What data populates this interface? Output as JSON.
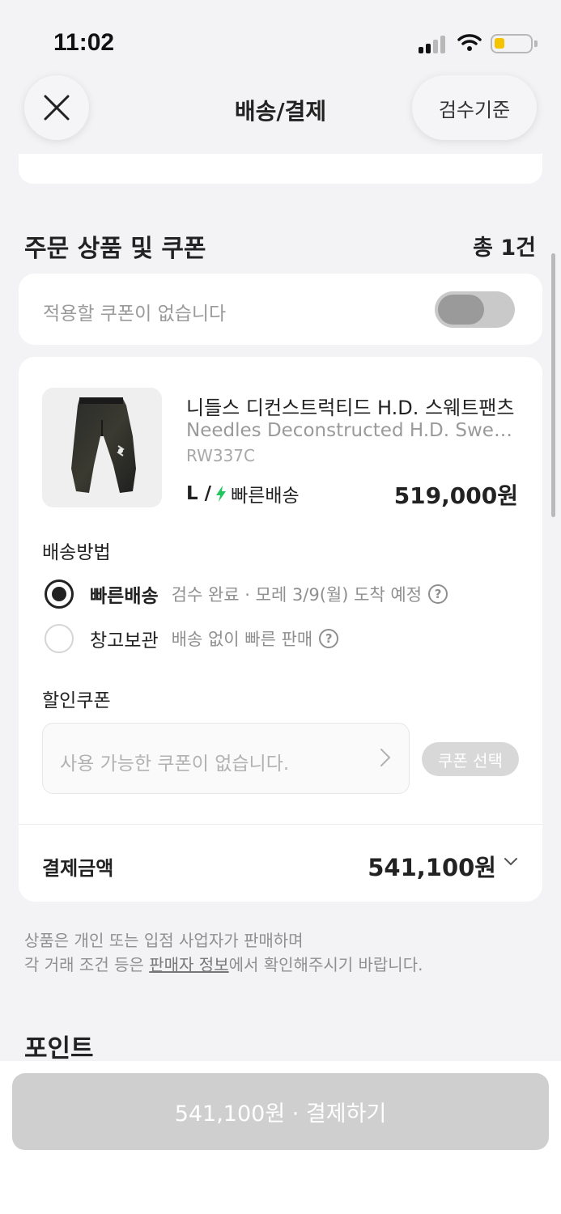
{
  "status_bar": {
    "time": "11:02"
  },
  "header": {
    "title": "배송/결제",
    "inspection_label": "검수기준"
  },
  "order_section": {
    "title": "주문 상품 및 쿠폰",
    "count": "총 1건"
  },
  "coupon_toggle": {
    "label": "적용할 쿠폰이 없습니다",
    "enabled": false
  },
  "product": {
    "name_ko": "니들스 디컨스트럭티드 H.D. 스웨트팬츠",
    "name_en": "Needles Deconstructed H.D. Sweat Pants",
    "code": "RW337C",
    "size": "L /",
    "delivery_badge": "빠른배송",
    "price": "519,000원"
  },
  "shipping": {
    "title": "배송방법",
    "options": [
      {
        "label": "빠른배송",
        "desc": "검수 완료 · 모레 3/9(월) 도착 예정",
        "selected": true
      },
      {
        "label": "창고보관",
        "desc": "배송 없이 빠른 판매",
        "selected": false
      }
    ],
    "help_glyph": "?"
  },
  "discount_coupon": {
    "title": "할인쿠폰",
    "placeholder": "사용 가능한 쿠폰이 없습니다.",
    "button": "쿠폰 선택"
  },
  "payment": {
    "label": "결제금액",
    "amount": "541,100원"
  },
  "notice": {
    "line1": "상품은 개인 또는 입점 사업자가 판매하며",
    "line2_prefix": "각 거래 조건 등은 ",
    "line2_link": "판매자 정보",
    "line2_suffix": "에서 확인해주시기 바랍니다."
  },
  "points": {
    "title": "포인트"
  },
  "footer": {
    "pay_button": "541,100원 · 결제하기"
  },
  "colors": {
    "accent_green": "#22c55e",
    "battery": "#f5c400",
    "disabled": "#cfcfcf"
  }
}
